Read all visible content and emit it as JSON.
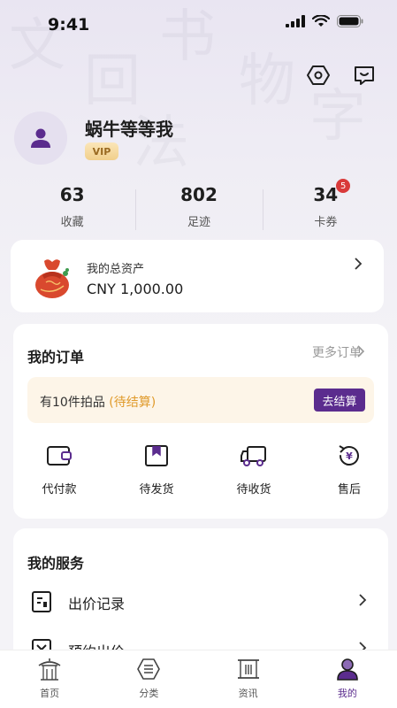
{
  "status_bar": {
    "time": "9:41"
  },
  "profile": {
    "username": "蜗牛等等我",
    "badge": "VIP"
  },
  "stats": [
    {
      "value": "63",
      "label": "收藏"
    },
    {
      "value": "802",
      "label": "足迹"
    },
    {
      "value": "34",
      "label": "卡券",
      "badge": "5"
    }
  ],
  "assets": {
    "label": "我的总资产",
    "value": "CNY 1,000.00"
  },
  "orders": {
    "title": "我的订单",
    "more": "更多订单",
    "pending_prefix": "有10件拍品",
    "pending_status": "(待结算)",
    "checkout": "去结算",
    "actions": [
      {
        "label": "代付款",
        "icon": "wallet-icon"
      },
      {
        "label": "待发货",
        "icon": "package-icon"
      },
      {
        "label": "待收货",
        "icon": "truck-icon"
      },
      {
        "label": "售后",
        "icon": "after-sale-icon"
      }
    ]
  },
  "services": {
    "title": "我的服务",
    "items": [
      {
        "label": "出价记录",
        "icon": "bid-record-icon"
      },
      {
        "label": "预约出价",
        "icon": "reserve-bid-icon"
      }
    ]
  },
  "nav": {
    "items": [
      {
        "label": "首页",
        "icon": "home-pavilion-icon"
      },
      {
        "label": "分类",
        "icon": "category-icon"
      },
      {
        "label": "资讯",
        "icon": "news-icon"
      },
      {
        "label": "我的",
        "icon": "profile-icon",
        "active": true
      }
    ]
  },
  "colors": {
    "accent": "#5b2c8e",
    "pending": "#e09a2a",
    "badge": "#d93a3a"
  }
}
